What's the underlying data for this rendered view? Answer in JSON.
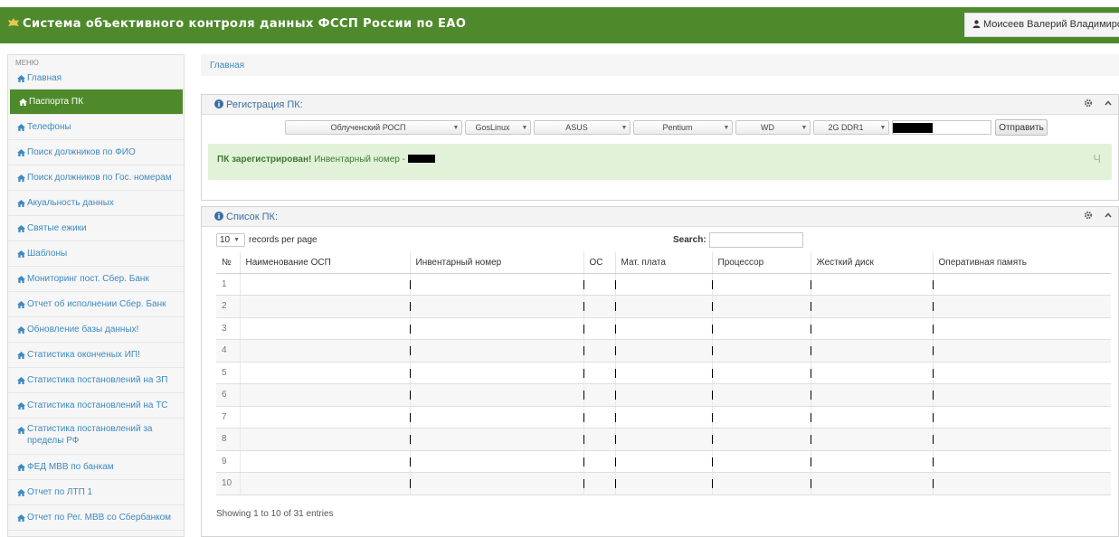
{
  "app": {
    "title": "Система объективного контроля данных ФССП России по ЕАО",
    "user": "Моисеев Валерий Владимирович"
  },
  "sidebar": {
    "header": "МЕНЮ",
    "items": [
      {
        "label": "Главная"
      },
      {
        "label": "Паспорта ПК",
        "active": true
      },
      {
        "label": "Телефоны"
      },
      {
        "label": "Поиск должников по ФИО"
      },
      {
        "label": "Поиск должников по Гос. номерам"
      },
      {
        "label": "Акуальность данных"
      },
      {
        "label": "Святые ежики"
      },
      {
        "label": "Шаблоны"
      },
      {
        "label": "Мониторинг пост. Сбер. Банк"
      },
      {
        "label": "Отчет об исполнении Сбер. Банк"
      },
      {
        "label": "Обновление базы данных!"
      },
      {
        "label": "Статистика оконченых ИП!"
      },
      {
        "label": "Статистика постановлений на ЗП"
      },
      {
        "label": "Статистика постановлений на ТС"
      },
      {
        "label": "Статистика постановлений за пределы РФ"
      },
      {
        "label": "ФЕД МВВ по банкам"
      },
      {
        "label": "Отчет по ЛТП 1"
      },
      {
        "label": "Отчет по Рег. МВВ со Сбербанком"
      }
    ]
  },
  "breadcrumb": "Главная",
  "registration": {
    "title": "Регистрация ПК:",
    "selects": [
      {
        "name": "osp-select",
        "value": "Облученский РОСП"
      },
      {
        "name": "os-select",
        "value": "GosLinux"
      },
      {
        "name": "motherboard-select",
        "value": "ASUS"
      },
      {
        "name": "cpu-select",
        "value": "Pentium"
      },
      {
        "name": "hdd-select",
        "value": "WD"
      },
      {
        "name": "ram-select",
        "value": "2G DDR1"
      }
    ],
    "submit_label": "Отправить",
    "alert_strong": "ПК зарегистрирован!",
    "alert_text": " Инвентарный номер - ",
    "alert_close": "Ч"
  },
  "pc_list": {
    "title": "Список ПК:",
    "page_length": "10",
    "records_label": "records per page",
    "search_label": "Search:",
    "columns": [
      "№",
      "Наименование ОСП",
      "Инвентарный номер",
      "ОС",
      "Мат. плата",
      "Процессор",
      "Жесткий диск",
      "Оперативная память"
    ],
    "rows": [
      "1",
      "2",
      "3",
      "4",
      "5",
      "6",
      "7",
      "8",
      "9",
      "10"
    ],
    "footer": "Showing 1 to 10 of 31 entries"
  },
  "colors": {
    "brand_green": "#4e8a2c",
    "link_blue": "#3d8ac2",
    "alert_bg": "#e1f2d9"
  },
  "icons": [
    "emblem-icon",
    "user-icon",
    "home-icon",
    "info-icon",
    "gear-icon",
    "chevron-up-icon"
  ]
}
